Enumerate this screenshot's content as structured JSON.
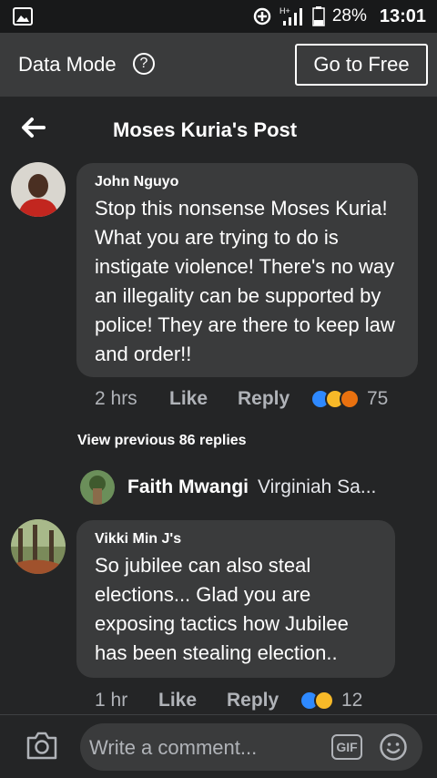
{
  "status_bar": {
    "battery": "28%",
    "time": "13:01",
    "signal": "H+"
  },
  "data_mode": {
    "label": "Data Mode",
    "help": "?",
    "button": "Go to Free"
  },
  "header": {
    "title": "Moses Kuria's Post"
  },
  "comments": [
    {
      "name": "John Nguyo",
      "text": "Stop this nonsense Moses Kuria! What you are trying to do is instigate violence! There's no way an illegality can be supported by police! They are there to keep law and order!!",
      "time": "2 hrs",
      "like_label": "Like",
      "reply_label": "Reply",
      "reaction_count": "75",
      "reactions": [
        "like",
        "haha",
        "angry"
      ]
    },
    {
      "name": "Vikki Min J's",
      "text": "So jubilee can also steal elections... Glad you are exposing tactics how Jubilee has been stealing election..",
      "time": "1 hr",
      "like_label": "Like",
      "reply_label": "Reply",
      "reaction_count": "12",
      "reactions": [
        "like",
        "haha"
      ]
    }
  ],
  "view_previous": "View previous 86 replies",
  "reply_preview": {
    "name": "Faith Mwangi",
    "text": "Virginiah Sa..."
  },
  "composer": {
    "placeholder": "Write a comment...",
    "gif": "GIF"
  }
}
